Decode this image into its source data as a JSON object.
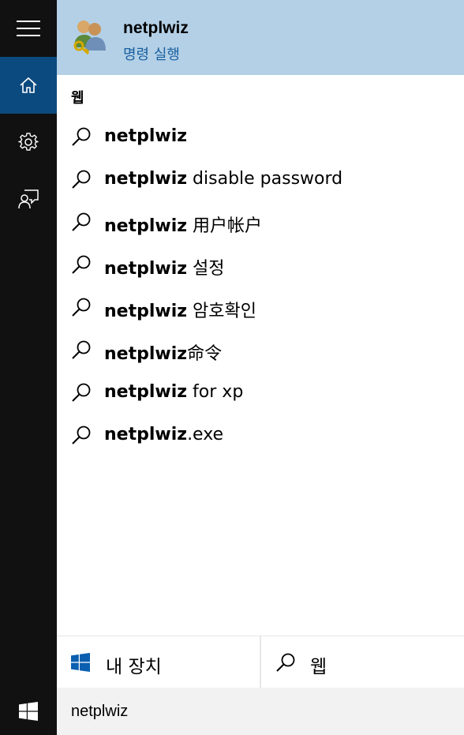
{
  "best_match": {
    "title": "netplwiz",
    "subtitle": "명령 실행",
    "icon": "users-keys-icon"
  },
  "section_heading": "웹",
  "suggestions": [
    {
      "bold": "netplwiz",
      "rest": ""
    },
    {
      "bold": "netplwiz",
      "rest": " disable password"
    },
    {
      "bold": "netplwiz",
      "rest": " 用户帐户"
    },
    {
      "bold": "netplwiz",
      "rest": " 설정"
    },
    {
      "bold": "netplwiz",
      "rest": " 암호확인"
    },
    {
      "bold": "netplwiz",
      "rest": "命令"
    },
    {
      "bold": "netplwiz",
      "rest": " for xp"
    },
    {
      "bold": "netplwiz",
      "rest": ".exe"
    }
  ],
  "bottom": {
    "my_device_label": "내 장치",
    "web_label": "웹"
  },
  "search": {
    "value": "netplwiz"
  },
  "colors": {
    "rail_bg": "#111111",
    "rail_active": "#0b4a7e",
    "best_match_bg": "#b3d0e6",
    "subtitle": "#1a5fa0",
    "windows_blue": "#0a5fb0"
  },
  "icons": {
    "rail": [
      "hamburger-menu-icon",
      "home-icon",
      "settings-gear-icon",
      "feedback-icon"
    ],
    "suggestion": "search-icon",
    "start": "windows-logo-icon"
  }
}
